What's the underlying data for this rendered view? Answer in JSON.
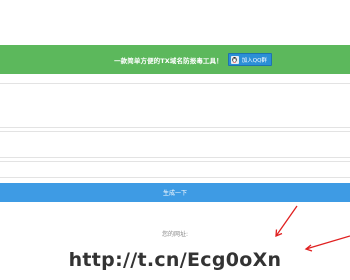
{
  "banner": {
    "text": "一款简单方便的TX域名防报毒工具！",
    "qq_button_label": "加入QQ群"
  },
  "form": {
    "submit_label": "生成一下"
  },
  "result": {
    "label": "您的网址:",
    "url": "http://t.cn/Ecg0oXn"
  },
  "colors": {
    "banner_bg": "#5cb85c",
    "submit_bg": "#3e9be4",
    "arrow": "#e02020"
  },
  "icons": {
    "qq": "qq-penguin-icon",
    "arrow": "red-annotation-arrow"
  }
}
